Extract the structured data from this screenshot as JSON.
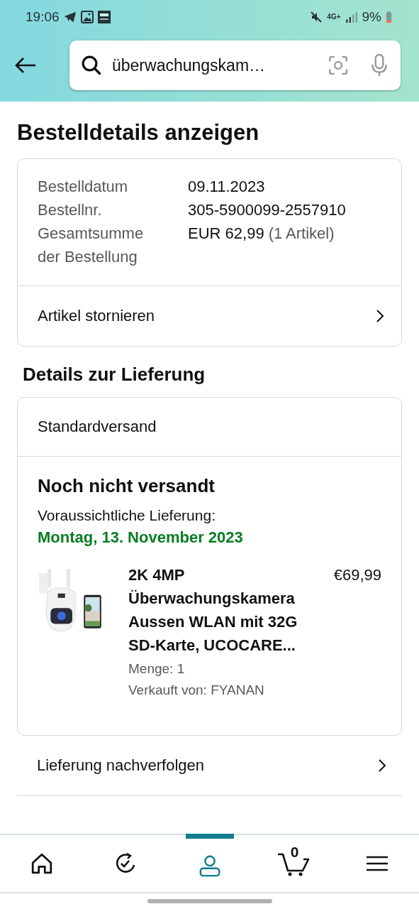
{
  "status_bar": {
    "time": "19:06",
    "network": "4G+",
    "battery": "9%"
  },
  "search": {
    "value": "überwachungskam…"
  },
  "title": "Bestelldetails anzeigen",
  "order_summary": {
    "rows": [
      {
        "label": "Bestelldatum",
        "value": "09.11.2023"
      },
      {
        "label": "Bestellnr.",
        "value": "305-5900099-2557910"
      },
      {
        "label": "Gesamtsumme der Bestellung",
        "value": "EUR 62,99",
        "note": "(1 Artikel)"
      }
    ],
    "action": "Artikel stornieren"
  },
  "delivery_heading": "Details zur Lieferung",
  "delivery": {
    "method": "Standardversand",
    "status": "Noch nicht versandt",
    "expected_label": "Voraussichtliche Lieferung:",
    "expected_date": "Montag, 13. November 2023",
    "item": {
      "kind": "picture",
      "title": "2K 4MP Überwachungskamera Aussen WLAN mit 32G SD-Karte, UCOCARE...",
      "price": "€69,99",
      "quantity": "Menge: 1",
      "seller": "Verkauft von: FYANAN"
    }
  },
  "track_link": "Lieferung nachverfolgen",
  "bottom_nav": [
    {
      "kind": "home",
      "selected": false
    },
    {
      "kind": "rebuy",
      "selected": false
    },
    {
      "kind": "account",
      "selected": true
    },
    {
      "kind": "cart",
      "selected": false,
      "count": "0"
    },
    {
      "kind": "menu",
      "selected": false
    }
  ]
}
